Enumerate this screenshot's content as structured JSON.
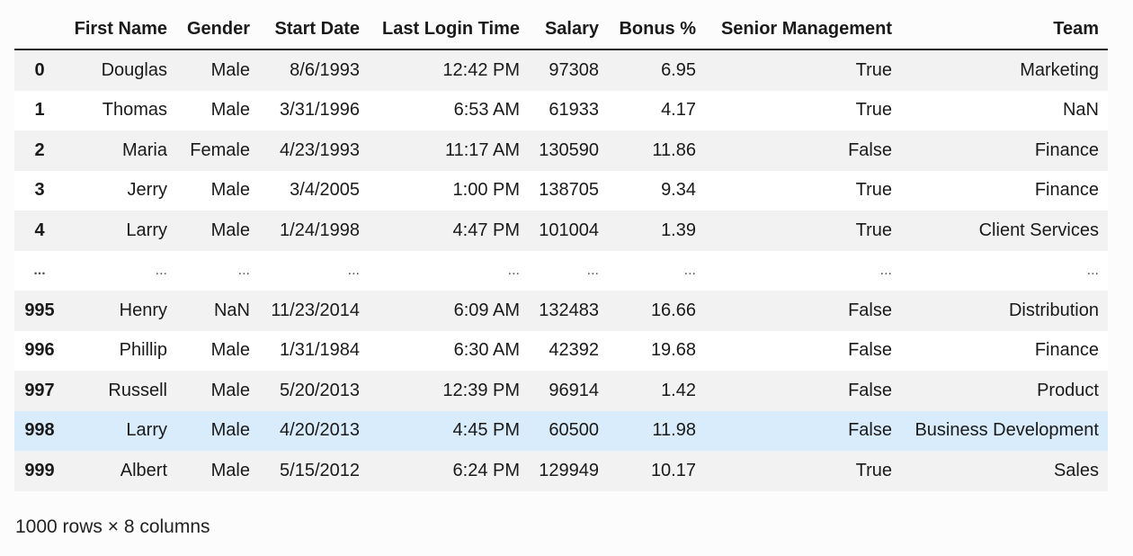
{
  "table": {
    "columns": [
      "",
      "First Name",
      "Gender",
      "Start Date",
      "Last Login Time",
      "Salary",
      "Bonus %",
      "Senior Management",
      "Team"
    ],
    "rows": [
      [
        "0",
        "Douglas",
        "Male",
        "8/6/1993",
        "12:42 PM",
        "97308",
        "6.95",
        "True",
        "Marketing"
      ],
      [
        "1",
        "Thomas",
        "Male",
        "3/31/1996",
        "6:53 AM",
        "61933",
        "4.17",
        "True",
        "NaN"
      ],
      [
        "2",
        "Maria",
        "Female",
        "4/23/1993",
        "11:17 AM",
        "130590",
        "11.86",
        "False",
        "Finance"
      ],
      [
        "3",
        "Jerry",
        "Male",
        "3/4/2005",
        "1:00 PM",
        "138705",
        "9.34",
        "True",
        "Finance"
      ],
      [
        "4",
        "Larry",
        "Male",
        "1/24/1998",
        "4:47 PM",
        "101004",
        "1.39",
        "True",
        "Client Services"
      ],
      [
        "...",
        "...",
        "...",
        "...",
        "...",
        "...",
        "...",
        "...",
        "..."
      ],
      [
        "995",
        "Henry",
        "NaN",
        "11/23/2014",
        "6:09 AM",
        "132483",
        "16.66",
        "False",
        "Distribution"
      ],
      [
        "996",
        "Phillip",
        "Male",
        "1/31/1984",
        "6:30 AM",
        "42392",
        "19.68",
        "False",
        "Finance"
      ],
      [
        "997",
        "Russell",
        "Male",
        "5/20/2013",
        "12:39 PM",
        "96914",
        "1.42",
        "False",
        "Product"
      ],
      [
        "998",
        "Larry",
        "Male",
        "4/20/2013",
        "4:45 PM",
        "60500",
        "11.98",
        "False",
        "Business Development"
      ],
      [
        "999",
        "Albert",
        "Male",
        "5/15/2012",
        "6:24 PM",
        "129949",
        "10.17",
        "True",
        "Sales"
      ]
    ],
    "highlighted_row_index": "998"
  },
  "footer": {
    "shape_text": "1000 rows × 8 columns"
  },
  "colors": {
    "row_stripe": "#f2f2f2",
    "row_highlight": "#d9ecfb",
    "header_rule": "#222222"
  }
}
